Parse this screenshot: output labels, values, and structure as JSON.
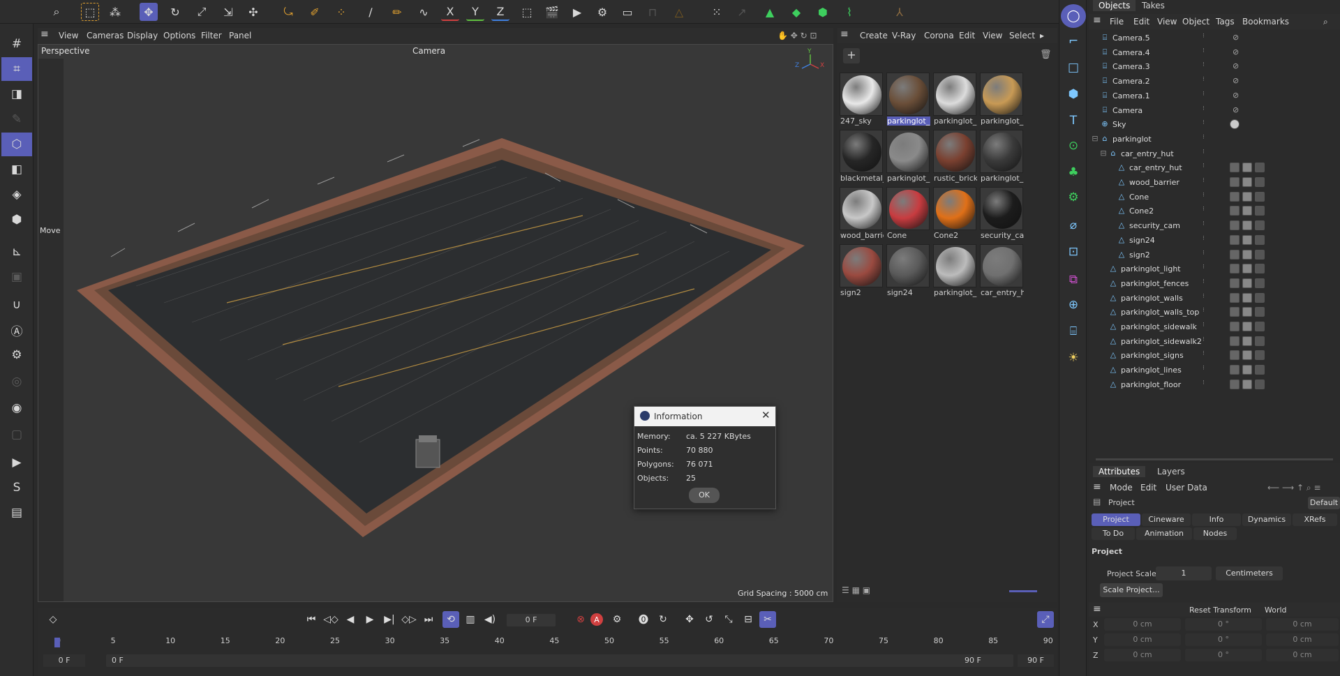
{
  "viewport": {
    "menu": [
      "View",
      "Cameras",
      "Display",
      "Options",
      "Filter",
      "Panel"
    ],
    "label_left": "Perspective",
    "label_camera": "Camera",
    "move_label": "Move",
    "grid_spacing": "Grid Spacing : 5000 cm",
    "axis": {
      "y": "Y",
      "z": "Z",
      "x": "X"
    }
  },
  "toolbar": {
    "axis_x": "X",
    "axis_y": "Y",
    "axis_z": "Z"
  },
  "material_menu": [
    "Create",
    "V-Ray",
    "Corona",
    "Edit",
    "View",
    "Select"
  ],
  "materials": [
    {
      "name": "247_sky",
      "color": "#e8e8e8"
    },
    {
      "name": "parkinglot_",
      "color": "#6a4e38",
      "selected": true
    },
    {
      "name": "parkinglot_",
      "color": "#dcdcdc"
    },
    {
      "name": "parkinglot_l",
      "color": "#c89a55"
    },
    {
      "name": "blackmetal_",
      "color": "#262626"
    },
    {
      "name": "parkinglot_",
      "color": "#8a8a8a"
    },
    {
      "name": "rustic_brick",
      "color": "#7a4030"
    },
    {
      "name": "parkinglot_",
      "color": "#3a3a3a"
    },
    {
      "name": "wood_barrie",
      "color": "#c8c8c8"
    },
    {
      "name": "Cone",
      "color": "#c83c40"
    },
    {
      "name": "Cone2",
      "color": "#e07018"
    },
    {
      "name": "security_car",
      "color": "#1c1c1c"
    },
    {
      "name": "sign2",
      "color": "#9a4a40"
    },
    {
      "name": "sign24",
      "color": "#5a5a5a"
    },
    {
      "name": "parkinglot_l",
      "color": "#bcbcbc"
    },
    {
      "name": "car_entry_h",
      "color": "#707070"
    }
  ],
  "objects_panel": {
    "tabs": [
      "Objects",
      "Takes"
    ],
    "menu": [
      "File",
      "Edit",
      "View",
      "Object",
      "Tags",
      "Bookmarks"
    ],
    "rows": [
      {
        "name": "Camera.5",
        "icon": "camera-icon",
        "indent": 0
      },
      {
        "name": "Camera.4",
        "icon": "camera-icon",
        "indent": 0
      },
      {
        "name": "Camera.3",
        "icon": "camera-icon",
        "indent": 0
      },
      {
        "name": "Camera.2",
        "icon": "camera-icon",
        "indent": 0
      },
      {
        "name": "Camera.1",
        "icon": "camera-icon",
        "indent": 0
      },
      {
        "name": "Camera",
        "icon": "camera-icon",
        "indent": 0
      },
      {
        "name": "Sky",
        "icon": "sky-icon",
        "indent": 0
      },
      {
        "name": "parkinglot",
        "icon": "null-icon",
        "indent": 0
      },
      {
        "name": "car_entry_hut",
        "icon": "null-icon",
        "indent": 1
      },
      {
        "name": "car_entry_hut",
        "icon": "mesh-icon",
        "indent": 2
      },
      {
        "name": "wood_barrier",
        "icon": "mesh-icon",
        "indent": 2
      },
      {
        "name": "Cone",
        "icon": "mesh-icon",
        "indent": 2
      },
      {
        "name": "Cone2",
        "icon": "mesh-icon",
        "indent": 2
      },
      {
        "name": "security_cam",
        "icon": "mesh-icon",
        "indent": 2
      },
      {
        "name": "sign24",
        "icon": "mesh-icon",
        "indent": 2
      },
      {
        "name": "sign2",
        "icon": "mesh-icon",
        "indent": 2
      },
      {
        "name": "parkinglot_light",
        "icon": "mesh-icon",
        "indent": 1
      },
      {
        "name": "parkinglot_fences",
        "icon": "mesh-icon",
        "indent": 1
      },
      {
        "name": "parkinglot_walls",
        "icon": "mesh-icon",
        "indent": 1
      },
      {
        "name": "parkinglot_walls_top",
        "icon": "mesh-icon",
        "indent": 1
      },
      {
        "name": "parkinglot_sidewalk",
        "icon": "mesh-icon",
        "indent": 1
      },
      {
        "name": "parkinglot_sidewalk2",
        "icon": "mesh-icon",
        "indent": 1
      },
      {
        "name": "parkinglot_signs",
        "icon": "mesh-icon",
        "indent": 1
      },
      {
        "name": "parkinglot_lines",
        "icon": "mesh-icon",
        "indent": 1
      },
      {
        "name": "parkinglot_floor",
        "icon": "mesh-icon",
        "indent": 1
      }
    ]
  },
  "attributes": {
    "tabs": [
      "Attributes",
      "Layers"
    ],
    "menu": [
      "Mode",
      "Edit",
      "User Data"
    ],
    "object": "Project",
    "preset": "Default",
    "subtabs": [
      "Project",
      "Cineware",
      "Info",
      "Dynamics",
      "XRefs"
    ],
    "subtabs2": [
      "To Do",
      "Animation",
      "Nodes"
    ],
    "section": "Project",
    "scale_label": "Project Scale",
    "scale_value": "1",
    "scale_unit": "Centimeters",
    "scale_button": "Scale Project...",
    "reset_transform": "Reset Transform",
    "space": "World",
    "coords": [
      {
        "axis": "X",
        "pos": "0 cm",
        "rot": "0 °",
        "scale": "0 cm"
      },
      {
        "axis": "Y",
        "pos": "0 cm",
        "rot": "0 °",
        "scale": "0 cm"
      },
      {
        "axis": "Z",
        "pos": "0 cm",
        "rot": "0 °",
        "scale": "0 cm"
      }
    ]
  },
  "timeline": {
    "current_frame": "0 F",
    "start_frame": "0 F",
    "range_start": "0 F",
    "range_end": "90 F",
    "end_frame": "90 F",
    "ticks": [
      "0",
      "5",
      "10",
      "15",
      "20",
      "25",
      "30",
      "35",
      "40",
      "45",
      "50",
      "55",
      "60",
      "65",
      "70",
      "75",
      "80",
      "85",
      "90"
    ]
  },
  "info_dialog": {
    "title": "Information",
    "rows": [
      {
        "label": "Memory:",
        "value": "ca. 5 227 KBytes"
      },
      {
        "label": "Points:",
        "value": "70 880"
      },
      {
        "label": "Polygons:",
        "value": "76 071"
      },
      {
        "label": "Objects:",
        "value": "25"
      }
    ],
    "ok": "OK"
  }
}
